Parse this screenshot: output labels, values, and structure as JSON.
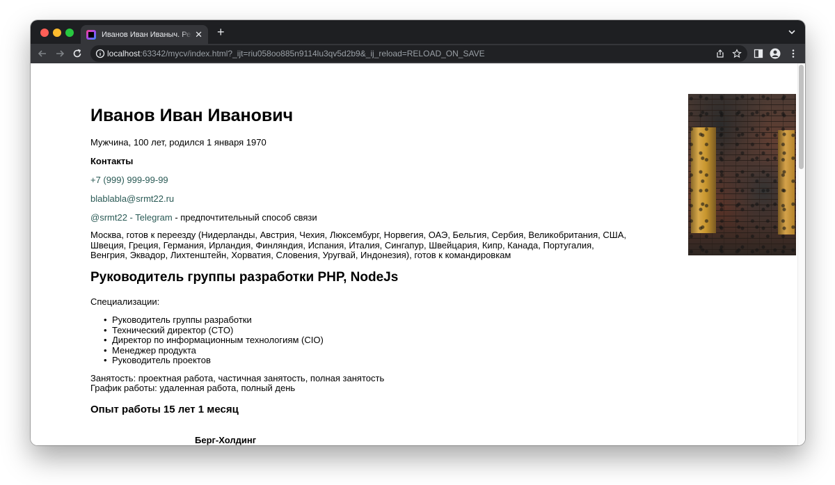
{
  "browser": {
    "tab_title": "Иванов Иван Иваныч. Резюме",
    "tab_close": "✕",
    "new_tab": "+",
    "url_host": "localhost",
    "url_rest": ":63342/mycv/index.html?_ijt=riu058oo885n9114lu3qv5d2b9&_ij_reload=RELOAD_ON_SAVE"
  },
  "resume": {
    "name": "Иванов Иван Иванович",
    "summary": "Мужчина, 100 лет, родился 1 января 1970",
    "contacts_heading": "Контакты",
    "phone": "+7 (999) 999-99-99",
    "email": "blablabla@srmt22.ru",
    "telegram_link": "@srmt22 - Telegram",
    "telegram_note": " - предпочтительный способ связи",
    "relocation": "Москва, готов к переезду (Нидерланды, Австрия, Чехия, Люксембург, Норвегия, ОАЭ, Бельгия, Сербия, Великобритания, США, Швеция, Греция, Германия, Ирландия, Финляндия, Испания, Италия, Сингапур, Швейцария, Кипр, Канада, Португалия, Венгрия, Эквадор, Лихтенштейн, Хорватия, Словения, Уругвай, Индонезия), готов к командировкам",
    "position": "Руководитель группы разработки PHP, NodeJs",
    "specializations_label": "Специализации:",
    "specializations": [
      "Руководитель группы разработки",
      "Технический директор (CTO)",
      "Директор по информационным технологиям (CIO)",
      "Менеджер продукта",
      "Руководитель проектов"
    ],
    "employment": "Занятость: проектная работа, частичная занятость, полная занятость",
    "schedule": "График работы: удаленная работа, полный день",
    "experience": "Опыт работы 15 лет 1 месяц",
    "company": "Берг-Холдинг"
  }
}
